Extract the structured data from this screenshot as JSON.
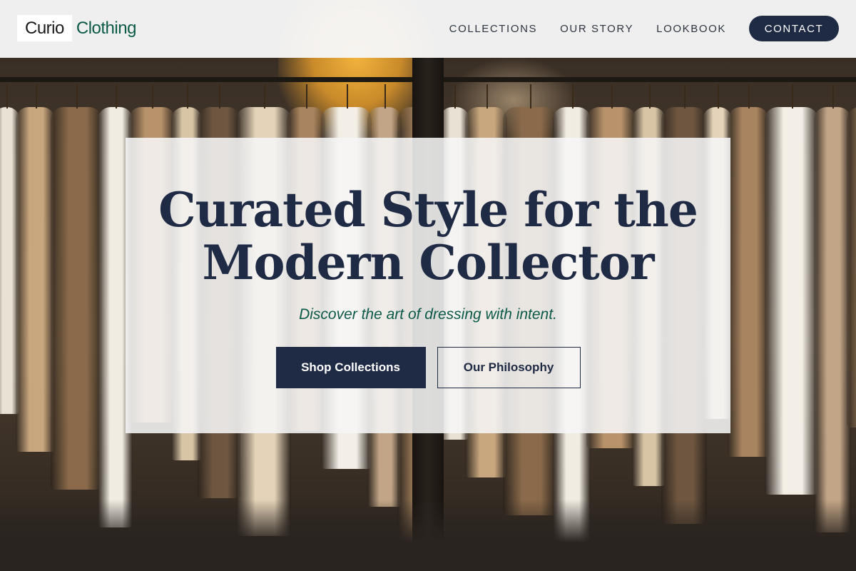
{
  "brand": {
    "logo_primary": "Curio",
    "logo_secondary": "Clothing"
  },
  "nav": {
    "links": [
      {
        "label": "COLLECTIONS"
      },
      {
        "label": "OUR STORY"
      },
      {
        "label": "LOOKBOOK"
      }
    ],
    "contact_label": "CONTACT"
  },
  "hero": {
    "headline_line1": "Curated Style for the",
    "headline_line2": "Modern Collector",
    "tagline": "Discover the art of dressing with intent.",
    "primary_cta": "Shop Collections",
    "secondary_cta": "Our Philosophy",
    "background_description_icon": "clothing-rack-photo"
  },
  "colors": {
    "navy": "#1f2a44",
    "green_accent": "#0c5a48",
    "header_bg": "#f6f6f6"
  }
}
